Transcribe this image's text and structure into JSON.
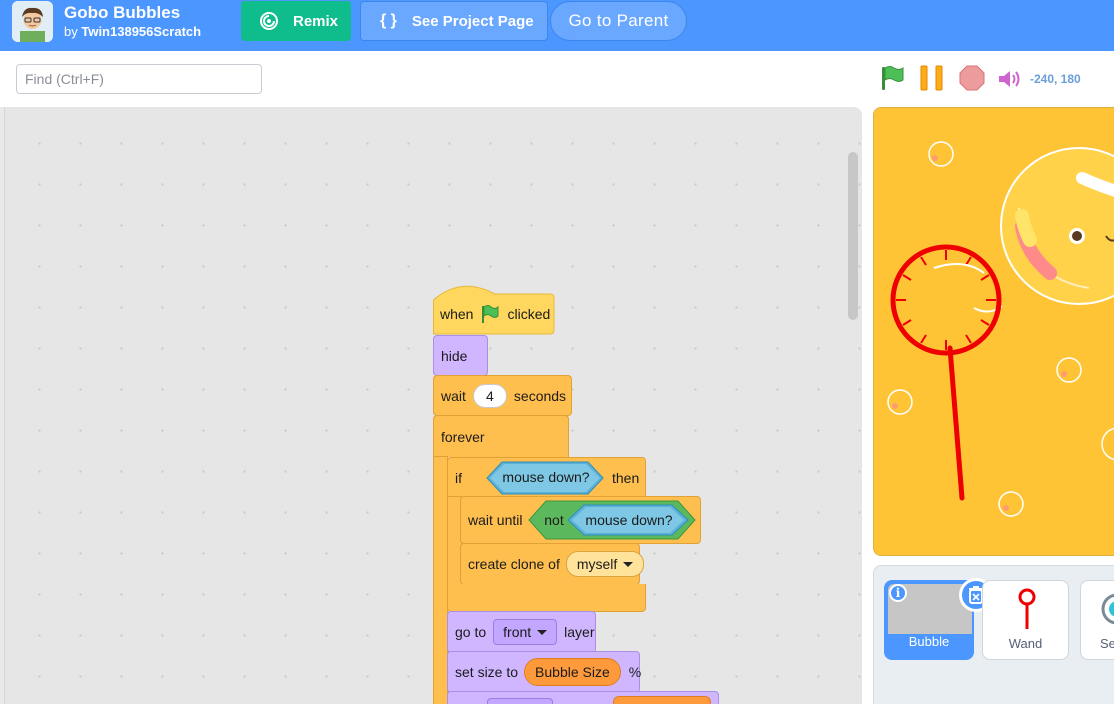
{
  "header": {
    "title": "Gobo Bubbles",
    "by_prefix": "by",
    "author": "Twin138956Scratch",
    "remix_label": "Remix",
    "see_project_label": "See Project Page",
    "go_parent_label": "Go to Parent"
  },
  "toolbar": {
    "find_placeholder": "Find (Ctrl+F)",
    "coords": "-240, 180",
    "icons": [
      "green-flag-icon",
      "pause-icon",
      "stop-icon",
      "speaker-icon"
    ]
  },
  "script": {
    "when_label": "when",
    "clicked_label": "clicked",
    "hide_label": "hide",
    "wait_label": "wait",
    "wait_value": "4",
    "seconds_label": "seconds",
    "forever_label": "forever",
    "if_label": "if",
    "then_label": "then",
    "mouse_down_label": "mouse down?",
    "wait_until_label": "wait until",
    "not_label": "not",
    "mouse_down_label2": "mouse down?",
    "create_clone_label": "create clone of",
    "clone_target": "myself",
    "go_to_label": "go to",
    "layer_target": "front",
    "layer_label": "layer",
    "set_size_label": "set size to",
    "size_variable": "Bubble Size",
    "percent_label": "%"
  },
  "sprites": {
    "items": [
      {
        "name": "Bubble",
        "selected": true
      },
      {
        "name": "Wand",
        "selected": false
      },
      {
        "name": "Se",
        "selected": false
      }
    ]
  },
  "colors": {
    "topbar": "#4c97ff",
    "remix": "#0fbd8c",
    "events": "#ffd75e",
    "looks": "#cfb6ff",
    "control": "#ffbf4f",
    "sensing": "#7ec8e6",
    "operators": "#78c96b",
    "stage": "#ffc435"
  }
}
